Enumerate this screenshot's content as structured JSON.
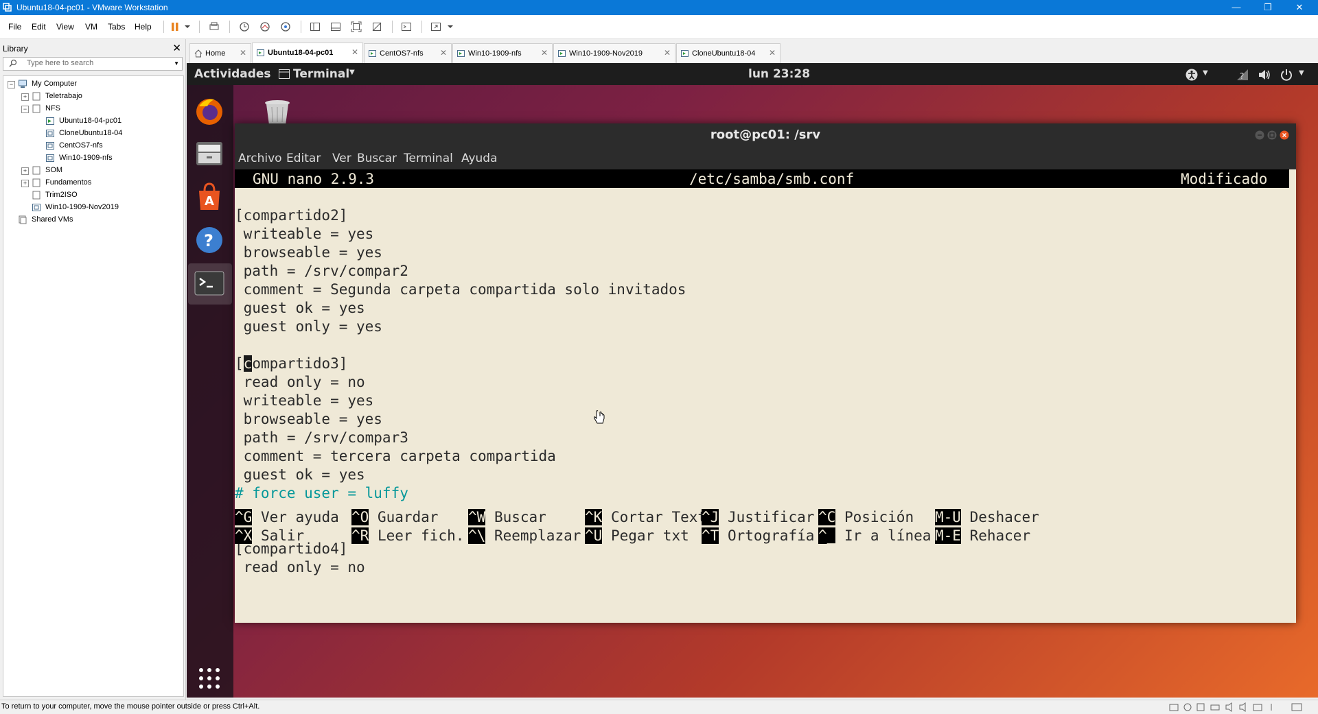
{
  "window": {
    "title": "Ubuntu18-04-pc01 - VMware Workstation",
    "controls": [
      "minimize",
      "restore",
      "close"
    ]
  },
  "menubar": {
    "items": [
      "File",
      "Edit",
      "View",
      "VM",
      "Tabs",
      "Help"
    ],
    "toolbar_icons": [
      "pause-icon",
      "dropdown-icon",
      "send-ctrl-alt-del-icon",
      "snapshot-icon",
      "revert-snapshot-icon",
      "snapshot-manager-icon",
      "show-library-icon",
      "thumbnail-bar-icon",
      "full-screen-icon",
      "unity-icon",
      "console-view-icon",
      "stretch-guest-icon"
    ]
  },
  "library": {
    "title": "Library",
    "search_placeholder": "Type here to search",
    "tree": [
      {
        "label": "My Computer",
        "level": 0,
        "expander": "−",
        "icon": "computer-icon"
      },
      {
        "label": "Teletrabajo",
        "level": 1,
        "expander": "+",
        "icon": "folder-icon"
      },
      {
        "label": "NFS",
        "level": 1,
        "expander": "−",
        "icon": "folder-icon"
      },
      {
        "label": "Ubuntu18-04-pc01",
        "level": 2,
        "expander": "",
        "icon": "vm-running-icon"
      },
      {
        "label": "CloneUbuntu18-04",
        "level": 2,
        "expander": "",
        "icon": "vm-icon"
      },
      {
        "label": "CentOS7-nfs",
        "level": 2,
        "expander": "",
        "icon": "vm-icon"
      },
      {
        "label": "Win10-1909-nfs",
        "level": 2,
        "expander": "",
        "icon": "vm-icon"
      },
      {
        "label": "SOM",
        "level": 1,
        "expander": "+",
        "icon": "folder-icon"
      },
      {
        "label": "Fundamentos",
        "level": 1,
        "expander": "+",
        "icon": "folder-icon"
      },
      {
        "label": "Trim2ISO",
        "level": 1,
        "expander": "",
        "icon": "folder-icon"
      },
      {
        "label": "Win10-1909-Nov2019",
        "level": 1,
        "expander": "",
        "icon": "vm-icon"
      },
      {
        "label": "Shared VMs",
        "level": 0,
        "expander": "",
        "icon": "shared-vms-icon"
      }
    ]
  },
  "tabs": [
    {
      "label": "Home",
      "active": false
    },
    {
      "label": "Ubuntu18-04-pc01",
      "active": true
    },
    {
      "label": "CentOS7-nfs",
      "active": false
    },
    {
      "label": "Win10-1909-nfs",
      "active": false
    },
    {
      "label": "Win10-1909-Nov2019",
      "active": false
    },
    {
      "label": "CloneUbuntu18-04",
      "active": false
    }
  ],
  "ubuntu": {
    "activities": "Actividades",
    "app_menu": "Terminal",
    "clock": "lun 23:28",
    "dock": [
      "firefox-icon",
      "files-icon",
      "software-icon",
      "help-icon",
      "terminal-icon",
      "show-apps-icon"
    ]
  },
  "terminal": {
    "title": "root@pc01: /srv",
    "menu": [
      "Archivo",
      "Editar",
      "Ver",
      "Buscar",
      "Terminal",
      "Ayuda"
    ],
    "nano": {
      "version": "GNU nano 2.9.3",
      "file": "/etc/samba/smb.conf",
      "status": "Modificado"
    },
    "lines": [
      {
        "text": "[compartido2]",
        "comment": false
      },
      {
        "text": " writeable = yes",
        "comment": false
      },
      {
        "text": " browseable = yes",
        "comment": false
      },
      {
        "text": " path = /srv/compar2",
        "comment": false
      },
      {
        "text": " comment = Segunda carpeta compartida solo invitados",
        "comment": false
      },
      {
        "text": " guest ok = yes",
        "comment": false
      },
      {
        "text": " guest only = yes",
        "comment": false
      },
      {
        "text": "",
        "comment": false
      },
      {
        "text": "[compartido3]",
        "comment": false,
        "cursor_at": 1
      },
      {
        "text": " read only = no",
        "comment": false
      },
      {
        "text": " writeable = yes",
        "comment": false
      },
      {
        "text": " browseable = yes",
        "comment": false
      },
      {
        "text": " path = /srv/compar3",
        "comment": false
      },
      {
        "text": " comment = tercera carpeta compartida",
        "comment": false
      },
      {
        "text": " guest ok = yes",
        "comment": false
      },
      {
        "text": "# force user = luffy",
        "comment": true
      },
      {
        "text": "",
        "comment": false
      },
      {
        "text": "",
        "comment": false
      },
      {
        "text": "[compartido4]",
        "comment": false
      },
      {
        "text": " read only = no",
        "comment": false
      }
    ],
    "shortcuts": [
      [
        {
          "key": "^G",
          "label": "Ver ayuda"
        },
        {
          "key": "^O",
          "label": "Guardar"
        },
        {
          "key": "^W",
          "label": "Buscar"
        },
        {
          "key": "^K",
          "label": "Cortar Texto"
        },
        {
          "key": "^J",
          "label": "Justificar"
        },
        {
          "key": "^C",
          "label": "Posición"
        },
        {
          "key": "M-U",
          "label": "Deshacer"
        }
      ],
      [
        {
          "key": "^X",
          "label": "Salir"
        },
        {
          "key": "^R",
          "label": "Leer fich."
        },
        {
          "key": "^\\",
          "label": "Reemplazar"
        },
        {
          "key": "^U",
          "label": "Pegar txt"
        },
        {
          "key": "^T",
          "label": "Ortografía"
        },
        {
          "key": "^_",
          "label": "Ir a línea"
        },
        {
          "key": "M-E",
          "label": "Rehacer"
        }
      ]
    ]
  },
  "statusbar": {
    "message": "To return to your computer, move the mouse pointer outside or press Ctrl+Alt."
  }
}
